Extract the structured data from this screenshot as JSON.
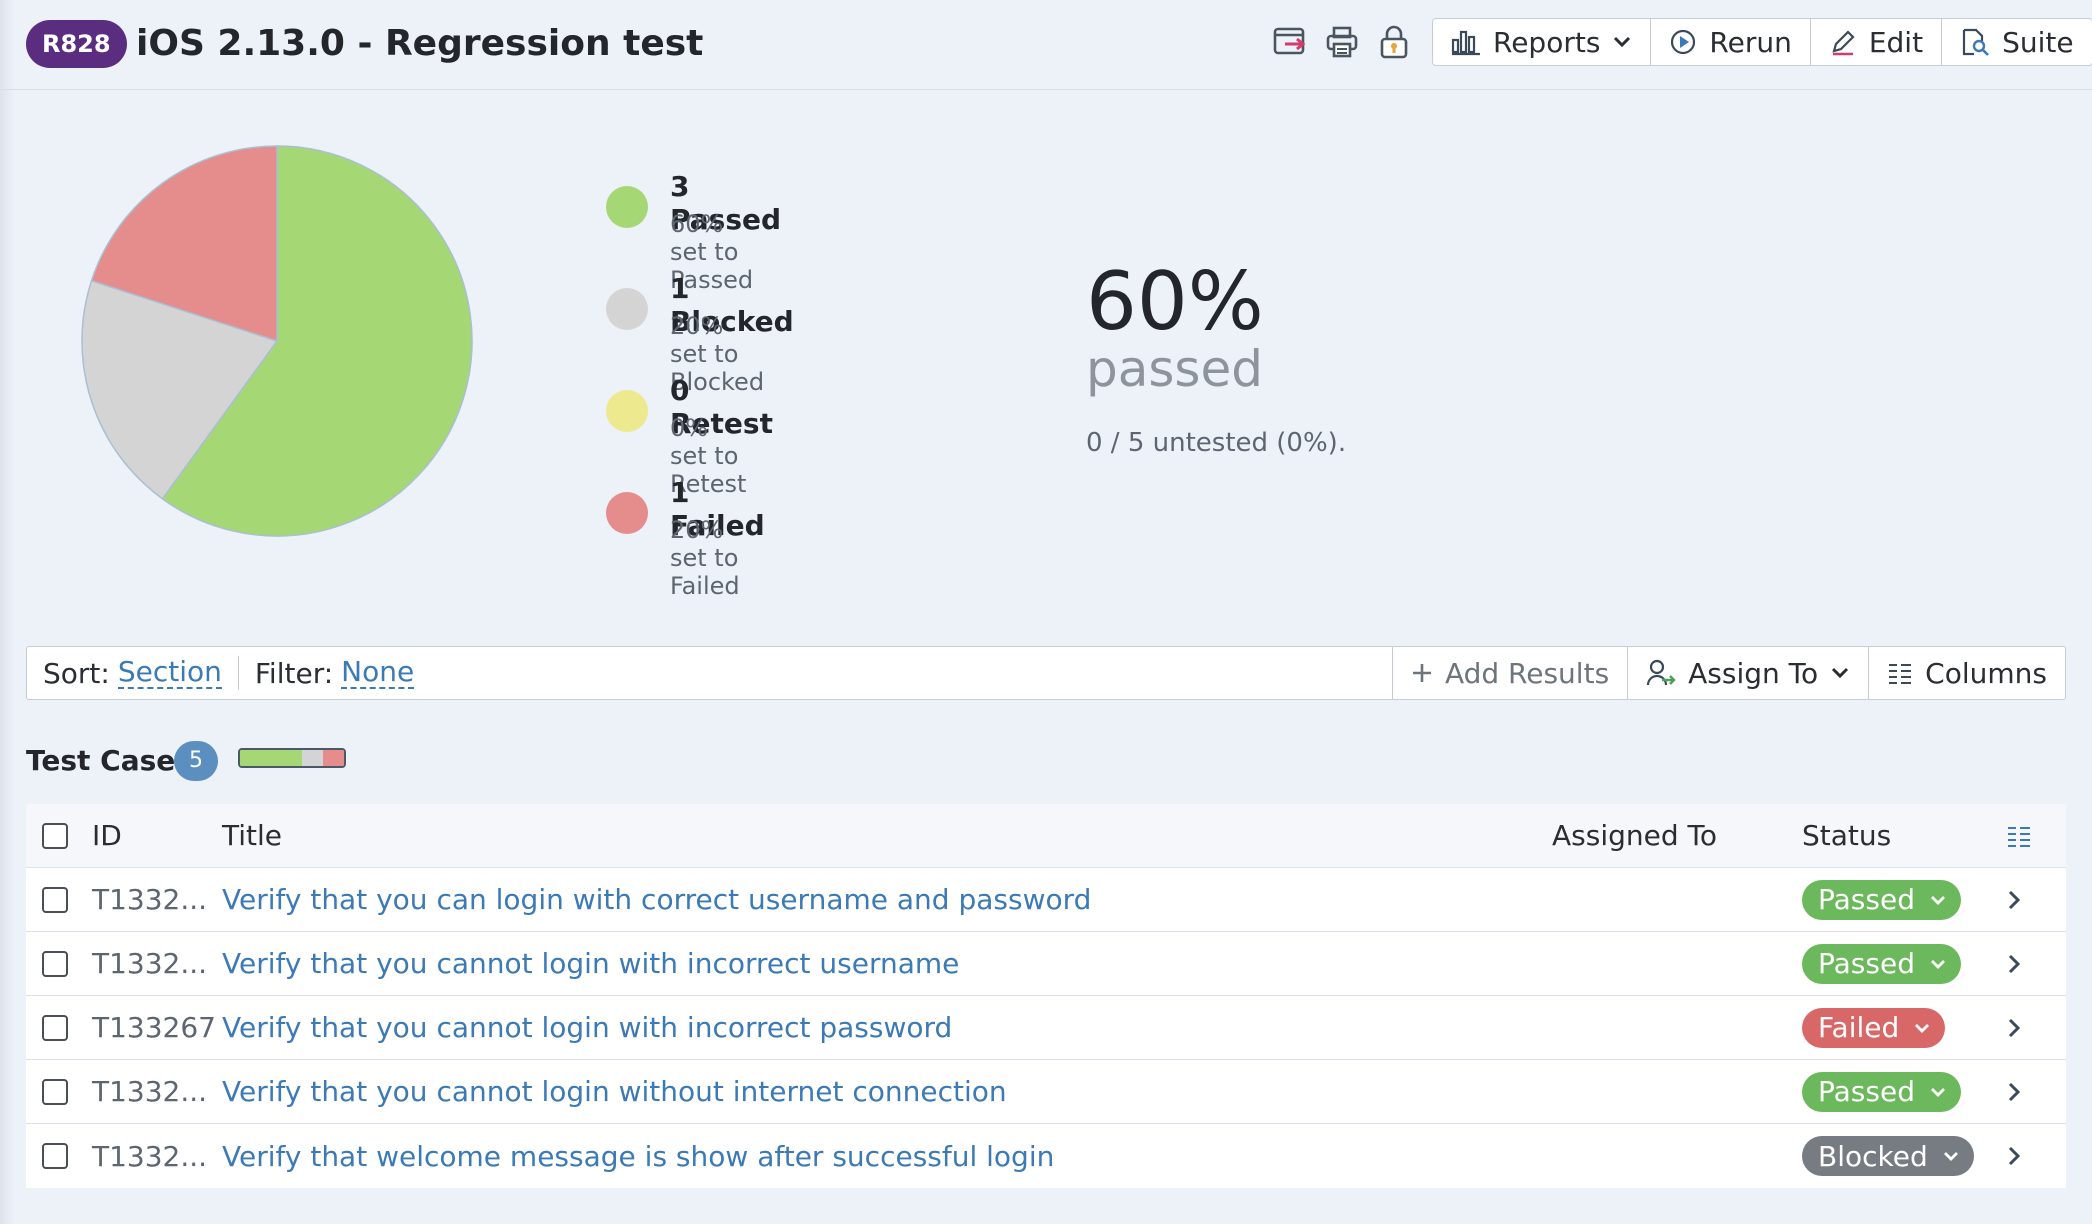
{
  "header": {
    "run_id": "R828",
    "title": "iOS 2.13.0 - Regression test",
    "buttons": {
      "reports": "Reports",
      "rerun": "Rerun",
      "edit": "Edit",
      "suite": "Suite"
    },
    "icons": [
      "export-icon",
      "print-icon",
      "lock-icon"
    ]
  },
  "summary": {
    "legend": [
      {
        "count": "3 Passed",
        "sub": "60% set to Passed",
        "color": "#a5d774"
      },
      {
        "count": "1 Blocked",
        "sub": "20% set to Blocked",
        "color": "#d4d4d4"
      },
      {
        "count": "0 Retest",
        "sub": "0% set to Retest",
        "color": "#ece98f"
      },
      {
        "count": "1 Failed",
        "sub": "20% set to Failed",
        "color": "#e58c8c"
      }
    ],
    "pie": [
      {
        "label": "Passed",
        "value": 3,
        "color": "#a5d774"
      },
      {
        "label": "Blocked",
        "value": 1,
        "color": "#d4d4d4"
      },
      {
        "label": "Retest",
        "value": 0,
        "color": "#ece98f"
      },
      {
        "label": "Failed",
        "value": 1,
        "color": "#e58c8c"
      }
    ],
    "percent": "60%",
    "percent_label": "passed",
    "untested": "0 / 5 untested (0%)."
  },
  "toolbar": {
    "sort_label": "Sort:",
    "sort_value": "Section",
    "filter_label": "Filter:",
    "filter_value": "None",
    "add_results": "Add Results",
    "assign_to": "Assign To",
    "columns": "Columns"
  },
  "section": {
    "title": "Test Cases",
    "count": "5",
    "progress": [
      {
        "status": "Passed",
        "fraction": 0.6,
        "color": "#a5d774"
      },
      {
        "status": "Blocked",
        "fraction": 0.2,
        "color": "#d4d4d4"
      },
      {
        "status": "Failed",
        "fraction": 0.2,
        "color": "#e58c8c"
      }
    ]
  },
  "table": {
    "columns": {
      "id": "ID",
      "title": "Title",
      "assigned": "Assigned To",
      "status": "Status"
    },
    "rows": [
      {
        "id": "T1332...",
        "title": "Verify that you can login with correct username and password",
        "assigned": "",
        "status": "Passed",
        "status_color": "#6cb85c"
      },
      {
        "id": "T1332...",
        "title": "Verify that you cannot login with incorrect username",
        "assigned": "",
        "status": "Passed",
        "status_color": "#6cb85c"
      },
      {
        "id": "T133267",
        "title": "Verify that you cannot login with incorrect password",
        "assigned": "",
        "status": "Failed",
        "status_color": "#d86767"
      },
      {
        "id": "T1332...",
        "title": "Verify that you cannot login without internet connection",
        "assigned": "",
        "status": "Passed",
        "status_color": "#6cb85c"
      },
      {
        "id": "T1332...",
        "title": "Verify that welcome message is show after successful login",
        "assigned": "",
        "status": "Blocked",
        "status_color": "#777c82"
      }
    ]
  }
}
